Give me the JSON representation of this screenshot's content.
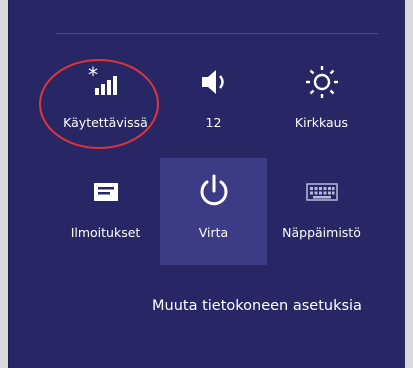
{
  "quick_settings": {
    "tiles": [
      {
        "label": "Käytettävissä",
        "icon": "network-signal-icon"
      },
      {
        "label": "12",
        "icon": "volume-icon"
      },
      {
        "label": "Kirkkaus",
        "icon": "brightness-icon"
      },
      {
        "label": "Ilmoitukset",
        "icon": "notifications-icon"
      },
      {
        "label": "Virta",
        "icon": "power-icon"
      },
      {
        "label": "Näppäimistö",
        "icon": "keyboard-icon"
      }
    ],
    "change_settings_link": "Muuta tietokoneen asetuksia"
  },
  "colors": {
    "panel_background": "#272766",
    "active_tile": "#3c3b86",
    "annotation_circle": "#e0333c"
  }
}
